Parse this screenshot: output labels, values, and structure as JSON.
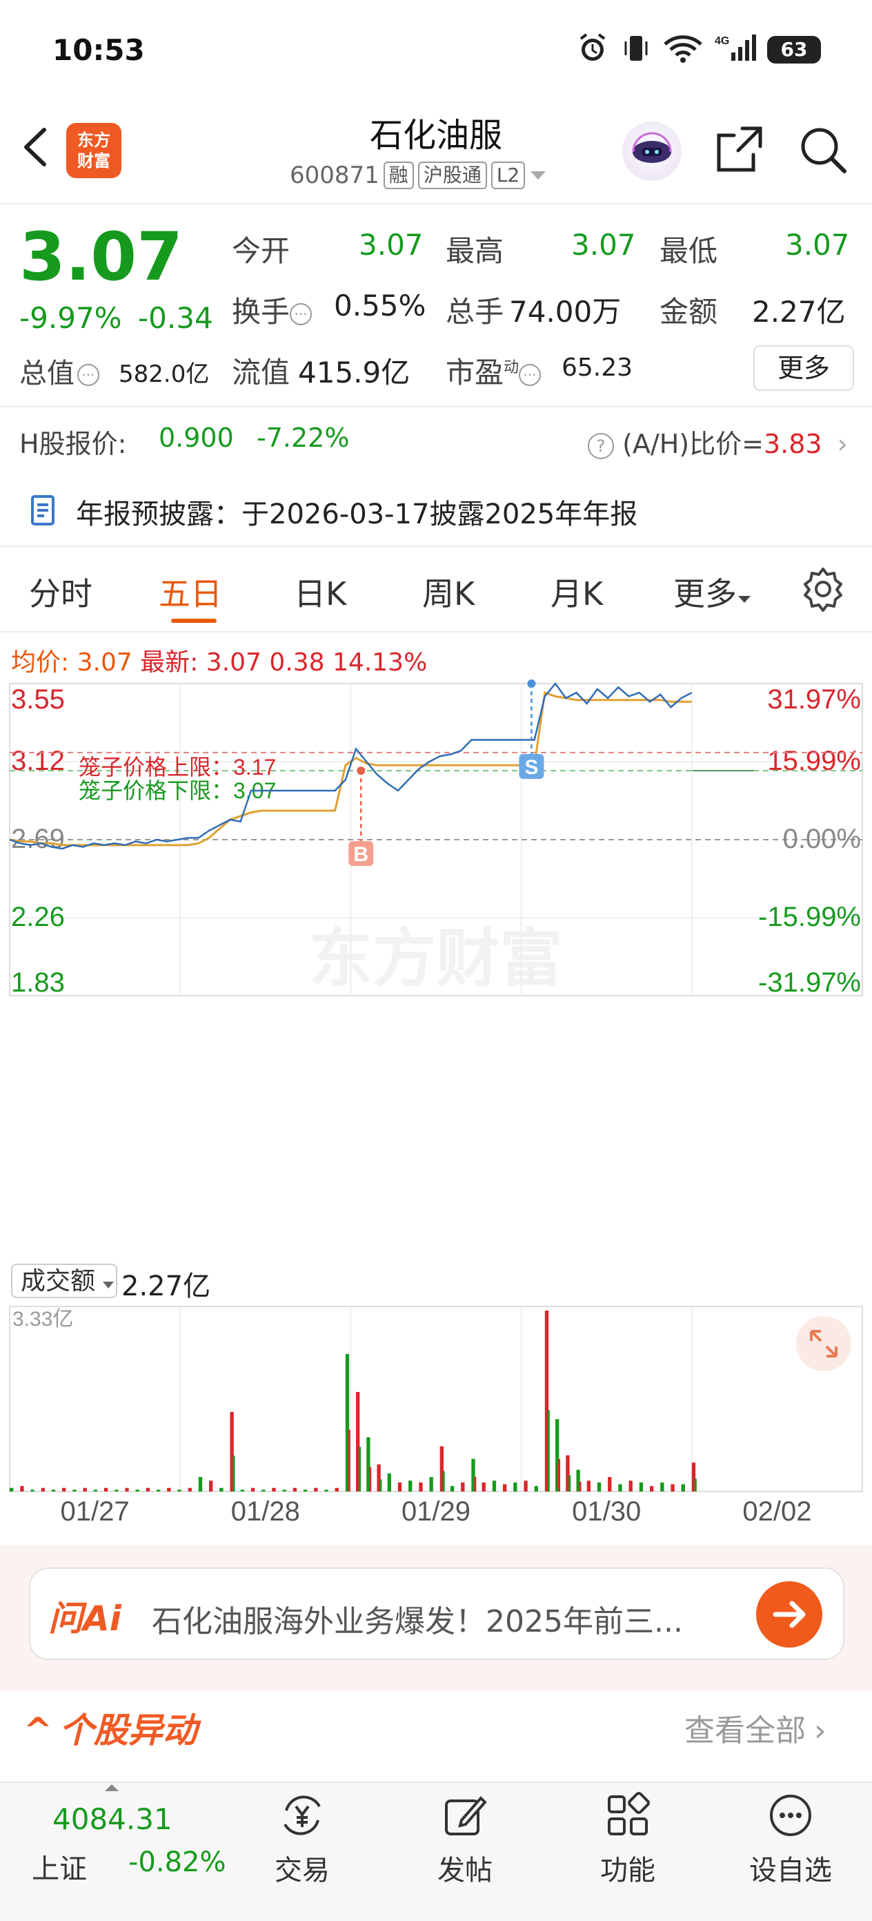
{
  "status_bar": {
    "time": "10:53",
    "battery": "63",
    "network": "4G"
  },
  "header": {
    "logo_text_1": "东方",
    "logo_text_2": "财富",
    "stock_name": "石化油服",
    "stock_code": "600871",
    "tags": [
      "融",
      "沪股通",
      "L2"
    ]
  },
  "quote": {
    "price": "3.07",
    "change_pct": "-9.97%",
    "change_val": "-0.34",
    "open_label": "今开",
    "open": "3.07",
    "high_label": "最高",
    "high": "3.07",
    "low_label": "最低",
    "low": "3.07",
    "turnover_label": "换手",
    "turnover": "0.55%",
    "volume_label": "总手",
    "volume": "74.00万",
    "amount_label": "金额",
    "amount": "2.27亿",
    "mktcap_label": "总值",
    "mktcap": "582.0亿",
    "float_label": "流值",
    "float": "415.9亿",
    "pe_label": "市盈",
    "pe_super": "动",
    "pe": "65.23",
    "more": "更多"
  },
  "hshare": {
    "label": "H股报价:",
    "price": "0.900",
    "pct": "-7.22%",
    "ratio_label": "(A/H)比价=",
    "ratio": "3.83"
  },
  "notice": {
    "text": "年报预披露：于2026-03-17披露2025年年报"
  },
  "tabs": [
    "分时",
    "五日",
    "日K",
    "周K",
    "月K",
    "更多"
  ],
  "active_tab": "五日",
  "avg_line": {
    "avg_label": "均价:",
    "avg": "3.07",
    "latest_label": "最新:",
    "latest": "3.07",
    "latest_chg": "0.38",
    "latest_pct": "14.13%"
  },
  "chart_data": {
    "type": "line",
    "y_left_ticks": [
      "3.55",
      "3.12",
      "2.69",
      "2.26",
      "1.83"
    ],
    "y_right_ticks": [
      "31.97%",
      "15.99%",
      "0.00%",
      "-15.99%",
      "-31.97%"
    ],
    "ylim": [
      1.83,
      3.55
    ],
    "prev_close": 2.69,
    "x_labels": [
      "01/27",
      "01/28",
      "01/29",
      "01/30",
      "02/02"
    ],
    "upper_limit_label": "笼子价格上限：3.17",
    "lower_limit_label": "笼子价格下限：3.07",
    "upper_limit": 3.17,
    "lower_limit": 3.07,
    "watermark": "东方财富",
    "markers": [
      {
        "label": "B",
        "day": 2,
        "price": 3.07
      },
      {
        "label": "S",
        "day": 3,
        "price": 3.55
      }
    ],
    "series": [
      {
        "values": [
          2.69,
          2.67,
          2.66,
          2.67,
          2.65,
          2.64,
          2.66,
          2.65,
          2.67,
          2.66,
          2.67,
          2.66,
          2.68,
          2.67,
          2.69,
          2.68,
          2.69,
          2.7,
          2.7,
          2.74,
          2.77,
          2.8,
          2.79,
          2.96,
          2.96,
          2.96,
          2.96,
          2.96,
          2.96,
          2.96,
          2.96,
          2.96,
          3.02,
          3.19,
          3.12,
          3.05,
          3.0,
          2.96,
          3.02,
          3.08,
          3.12,
          3.15,
          3.16,
          3.18,
          3.24,
          3.24,
          3.24,
          3.24,
          3.24,
          3.24,
          3.24,
          3.48,
          3.55,
          3.47,
          3.5,
          3.44,
          3.52,
          3.47,
          3.53,
          3.48,
          3.5,
          3.45,
          3.49,
          3.42,
          3.47,
          3.5
        ]
      },
      {
        "values": [
          2.69,
          2.68,
          2.68,
          2.67,
          2.67,
          2.66,
          2.66,
          2.66,
          2.66,
          2.66,
          2.66,
          2.66,
          2.66,
          2.66,
          2.66,
          2.66,
          2.66,
          2.66,
          2.67,
          2.7,
          2.75,
          2.8,
          2.82,
          2.84,
          2.85,
          2.85,
          2.85,
          2.85,
          2.85,
          2.85,
          2.85,
          2.85,
          3.1,
          3.14,
          3.11,
          3.1,
          3.1,
          3.1,
          3.1,
          3.1,
          3.1,
          3.1,
          3.1,
          3.1,
          3.1,
          3.1,
          3.1,
          3.1,
          3.1,
          3.1,
          3.1,
          3.5,
          3.48,
          3.47,
          3.46,
          3.46,
          3.46,
          3.46,
          3.46,
          3.46,
          3.46,
          3.46,
          3.46,
          3.45,
          3.45,
          3.45
        ]
      }
    ],
    "volume_label": "成交额",
    "volume_total": "2.27亿",
    "volume_max_label": "3.33亿",
    "volume_bars": [
      0.02,
      0.03,
      0.01,
      0.02,
      0.01,
      0.02,
      0.01,
      0.02,
      0.01,
      0.02,
      0.01,
      0.02,
      0.01,
      0.02,
      0.01,
      0.02,
      0.01,
      0.02,
      0.08,
      0.06,
      0.02,
      0.44,
      0.01,
      0.02,
      0.01,
      0.02,
      0.01,
      0.02,
      0.01,
      0.02,
      0.01,
      0.02,
      0.76,
      0.55,
      0.3,
      0.15,
      0.1,
      0.05,
      0.06,
      0.05,
      0.08,
      0.25,
      0.03,
      0.05,
      0.18,
      0.05,
      0.06,
      0.04,
      0.05,
      0.06,
      0.03,
      1.0,
      0.4,
      0.2,
      0.12,
      0.06,
      0.05,
      0.08,
      0.04,
      0.06,
      0.05,
      0.03,
      0.05,
      0.04,
      0.04,
      0.16
    ],
    "volume_colors": [
      "#169a1e",
      "#d9262c"
    ]
  },
  "ai": {
    "logo": "问Ai",
    "text": "石化油服海外业务爆发！2025年前三..."
  },
  "abnormal": {
    "title": "个股异动",
    "view_all": "查看全部"
  },
  "bottom_nav": {
    "index_val": "4084.31",
    "index_label": "上证",
    "index_pct": "-0.82%",
    "items": [
      "交易",
      "发帖",
      "功能",
      "设自选"
    ]
  },
  "colors": {
    "up": "#d9262c",
    "down": "#169a1e",
    "accent": "#e8590c",
    "price_line": "#2f6db5",
    "avg_line": "#e0a030"
  }
}
